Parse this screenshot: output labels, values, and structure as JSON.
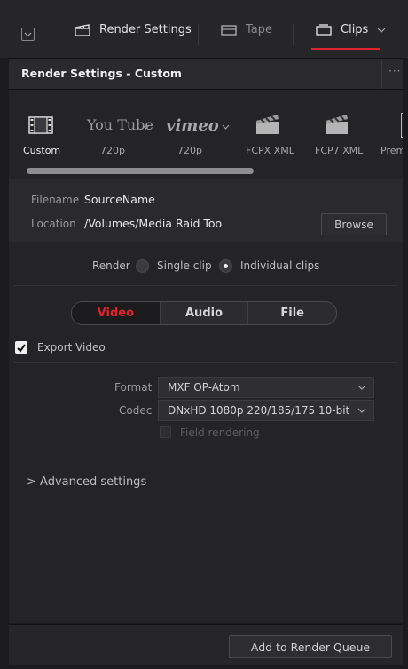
{
  "toolbar": {
    "render_settings_label": "Render Settings",
    "tape_label": "Tape",
    "clips_label": "Clips"
  },
  "header": {
    "title": "Render Settings - Custom",
    "menu_dots": "···"
  },
  "presets": [
    {
      "name": "custom",
      "label": "Custom"
    },
    {
      "name": "youtube",
      "brand": "You Tube",
      "label": "720p"
    },
    {
      "name": "vimeo",
      "brand": "vimeo",
      "label": "720p"
    },
    {
      "name": "fcpx",
      "label": "FCPX XML"
    },
    {
      "name": "fcp7",
      "label": "FCP7 XML"
    },
    {
      "name": "premiere",
      "label": "Prem"
    }
  ],
  "file": {
    "filename_label": "Filename",
    "filename_value": "SourceName",
    "location_label": "Location",
    "location_value": "/Volumes/Media Raid Too",
    "browse_label": "Browse"
  },
  "render": {
    "label": "Render",
    "single_clip": "Single clip",
    "individual_clips": "Individual clips",
    "selected": "individual_clips"
  },
  "tabs": [
    {
      "label": "Video",
      "active": true
    },
    {
      "label": "Audio",
      "active": false
    },
    {
      "label": "File",
      "active": false
    }
  ],
  "video": {
    "export_video_label": "Export Video",
    "export_video_checked": true,
    "format_label": "Format",
    "format_value": "MXF OP-Atom",
    "codec_label": "Codec",
    "codec_value": "DNxHD 1080p 220/185/175 10-bit",
    "field_rendering_label": "Field rendering"
  },
  "advanced": {
    "label": "> Advanced settings"
  },
  "footer": {
    "add_queue_label": "Add to Render Queue"
  },
  "colors": {
    "accent_red": "#e0232c",
    "panel": "#242427",
    "toolbar": "#262629"
  }
}
